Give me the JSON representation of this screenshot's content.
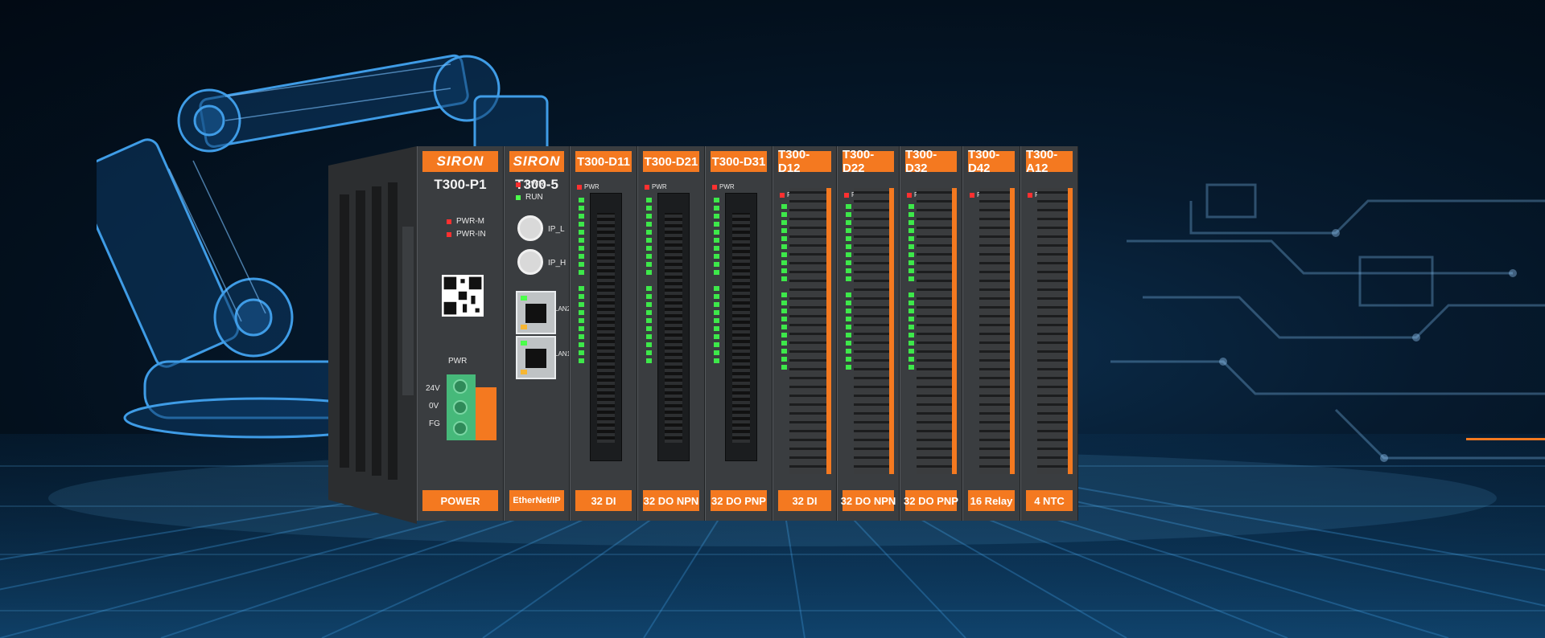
{
  "brand": "SIRON",
  "modules": [
    {
      "id": "p1",
      "header": "SIRON",
      "model": "T300-P1",
      "footer": "POWER",
      "leds": [
        "PWR-M",
        "PWR-IN"
      ],
      "power_label": "PWR",
      "power_terms": [
        "24V",
        "0V",
        "FG"
      ]
    },
    {
      "id": "s5",
      "header": "SIRON",
      "model": "T300-5",
      "footer": "EtherNet/IP",
      "leds": [
        "PWR",
        "RUN"
      ],
      "switches": [
        "IP_L",
        "IP_H"
      ],
      "ports": [
        "LAN2",
        "LAN1"
      ]
    },
    {
      "id": "d11",
      "header": "T300-D11",
      "footer": "32 DI",
      "led_label": "PWR"
    },
    {
      "id": "d21",
      "header": "T300-D21",
      "footer": "32 DO NPN",
      "led_label": "PWR"
    },
    {
      "id": "d31",
      "header": "T300-D31",
      "footer": "32 DO PNP",
      "led_label": "PWR"
    },
    {
      "id": "d12",
      "header": "T300-D12",
      "footer": "32 DI",
      "led_label": "PWR"
    },
    {
      "id": "d22",
      "header": "T300-D22",
      "footer": "32 DO NPN",
      "led_label": "PWR"
    },
    {
      "id": "d32",
      "header": "T300-D32",
      "footer": "32 DO PNP",
      "led_label": "PWR"
    },
    {
      "id": "d42",
      "header": "T300-D42",
      "footer": "16 Relay",
      "led_label": "PWR"
    },
    {
      "id": "a12",
      "header": "T300-A12",
      "footer": "4 NTC",
      "led_label": "PWR"
    }
  ],
  "colors": {
    "accent": "#f47920",
    "module_body": "#3a3d40",
    "led_green": "#3de84a",
    "led_red": "#ff3030",
    "background": "#04101e"
  }
}
